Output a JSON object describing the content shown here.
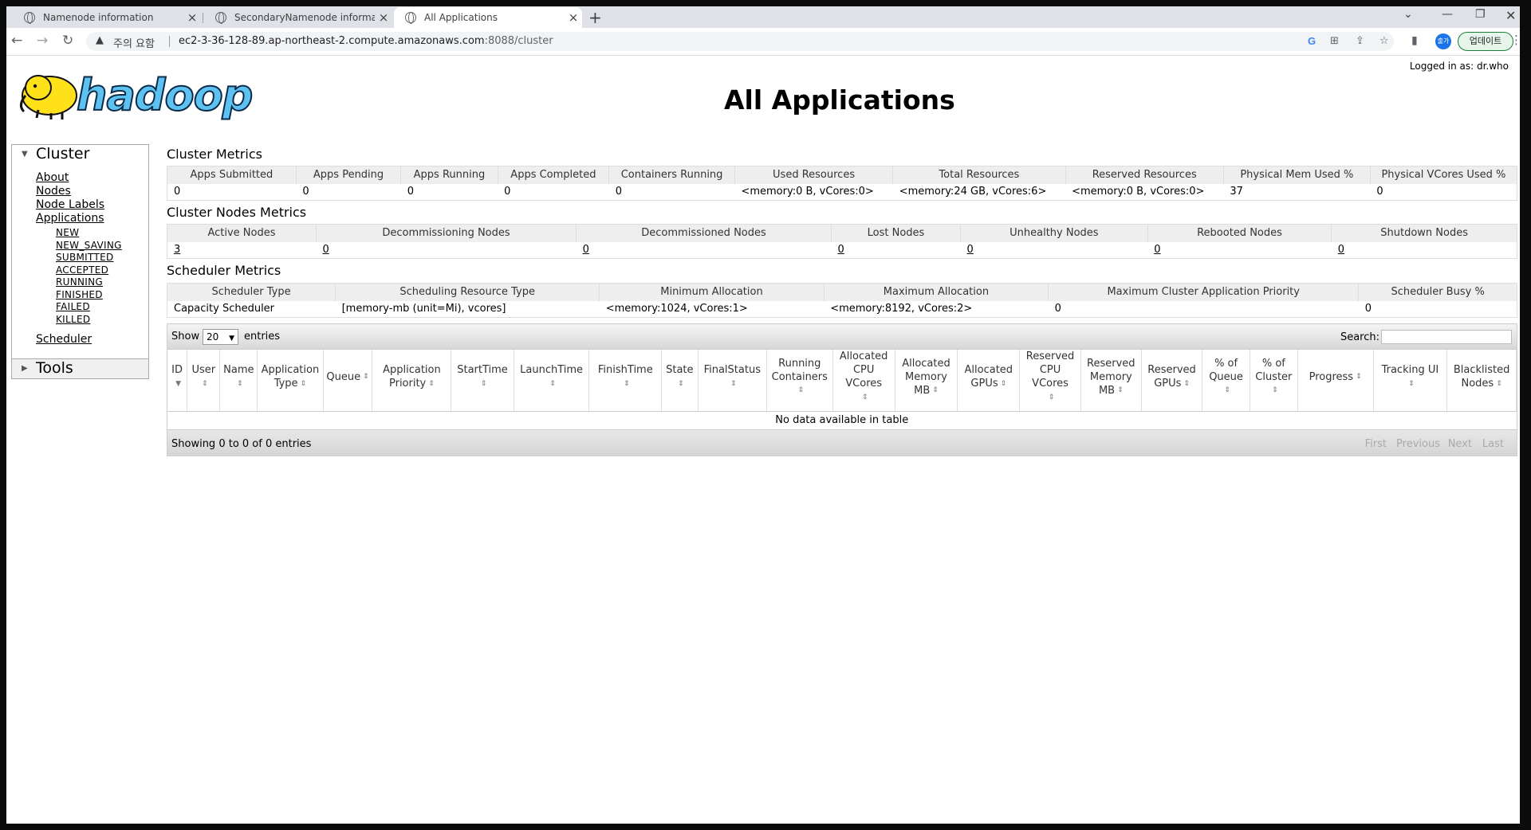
{
  "browser": {
    "tabs": [
      {
        "title": "Namenode information",
        "active": false
      },
      {
        "title": "SecondaryNamenode informatic",
        "active": false
      },
      {
        "title": "All Applications",
        "active": true
      }
    ],
    "warning_text": "주의 요함",
    "url_host": "ec2-3-36-128-89.ap-northeast-2.compute.amazonaws.com",
    "url_path": ":8088/cluster",
    "profile_label": "출가",
    "update_label": "업데이트"
  },
  "page": {
    "logged_in": "Logged in as: dr.who",
    "logo_text": "hadoop",
    "title": "All Applications"
  },
  "sidebar": {
    "cluster_label": "Cluster",
    "tools_label": "Tools",
    "links": [
      "About",
      "Nodes",
      "Node Labels",
      "Applications"
    ],
    "states": [
      "NEW",
      "NEW_SAVING",
      "SUBMITTED",
      "ACCEPTED",
      "RUNNING",
      "FINISHED",
      "FAILED",
      "KILLED"
    ],
    "scheduler": "Scheduler"
  },
  "cluster_metrics": {
    "title": "Cluster Metrics",
    "headers": [
      "Apps Submitted",
      "Apps Pending",
      "Apps Running",
      "Apps Completed",
      "Containers Running",
      "Used Resources",
      "Total Resources",
      "Reserved Resources",
      "Physical Mem Used %",
      "Physical VCores Used %"
    ],
    "values": [
      "0",
      "0",
      "0",
      "0",
      "0",
      "<memory:0 B, vCores:0>",
      "<memory:24 GB, vCores:6>",
      "<memory:0 B, vCores:0>",
      "37",
      "0"
    ]
  },
  "nodes_metrics": {
    "title": "Cluster Nodes Metrics",
    "headers": [
      "Active Nodes",
      "Decommissioning Nodes",
      "Decommissioned Nodes",
      "Lost Nodes",
      "Unhealthy Nodes",
      "Rebooted Nodes",
      "Shutdown Nodes"
    ],
    "values": [
      "3",
      "0",
      "0",
      "0",
      "0",
      "0",
      "0"
    ]
  },
  "scheduler_metrics": {
    "title": "Scheduler Metrics",
    "headers": [
      "Scheduler Type",
      "Scheduling Resource Type",
      "Minimum Allocation",
      "Maximum Allocation",
      "Maximum Cluster Application Priority",
      "Scheduler Busy %"
    ],
    "values": [
      "Capacity Scheduler",
      "[memory-mb (unit=Mi), vcores]",
      "<memory:1024, vCores:1>",
      "<memory:8192, vCores:2>",
      "0",
      "0"
    ]
  },
  "apps_table": {
    "show_label": "Show",
    "show_value": "20",
    "entries_label": "entries",
    "search_label": "Search:",
    "columns": [
      "ID",
      "User",
      "Name",
      "Application Type",
      "Queue",
      "Application Priority",
      "StartTime",
      "LaunchTime",
      "FinishTime",
      "State",
      "FinalStatus",
      "Running Containers",
      "Allocated CPU VCores",
      "Allocated Memory MB",
      "Allocated GPUs",
      "Reserved CPU VCores",
      "Reserved Memory MB",
      "Reserved GPUs",
      "% of Queue",
      "% of Cluster",
      "Progress",
      "Tracking UI",
      "Blacklisted Nodes"
    ],
    "empty_text": "No data available in table",
    "info_text": "Showing 0 to 0 of 0 entries",
    "pager": [
      "First",
      "Previous",
      "Next",
      "Last"
    ]
  }
}
